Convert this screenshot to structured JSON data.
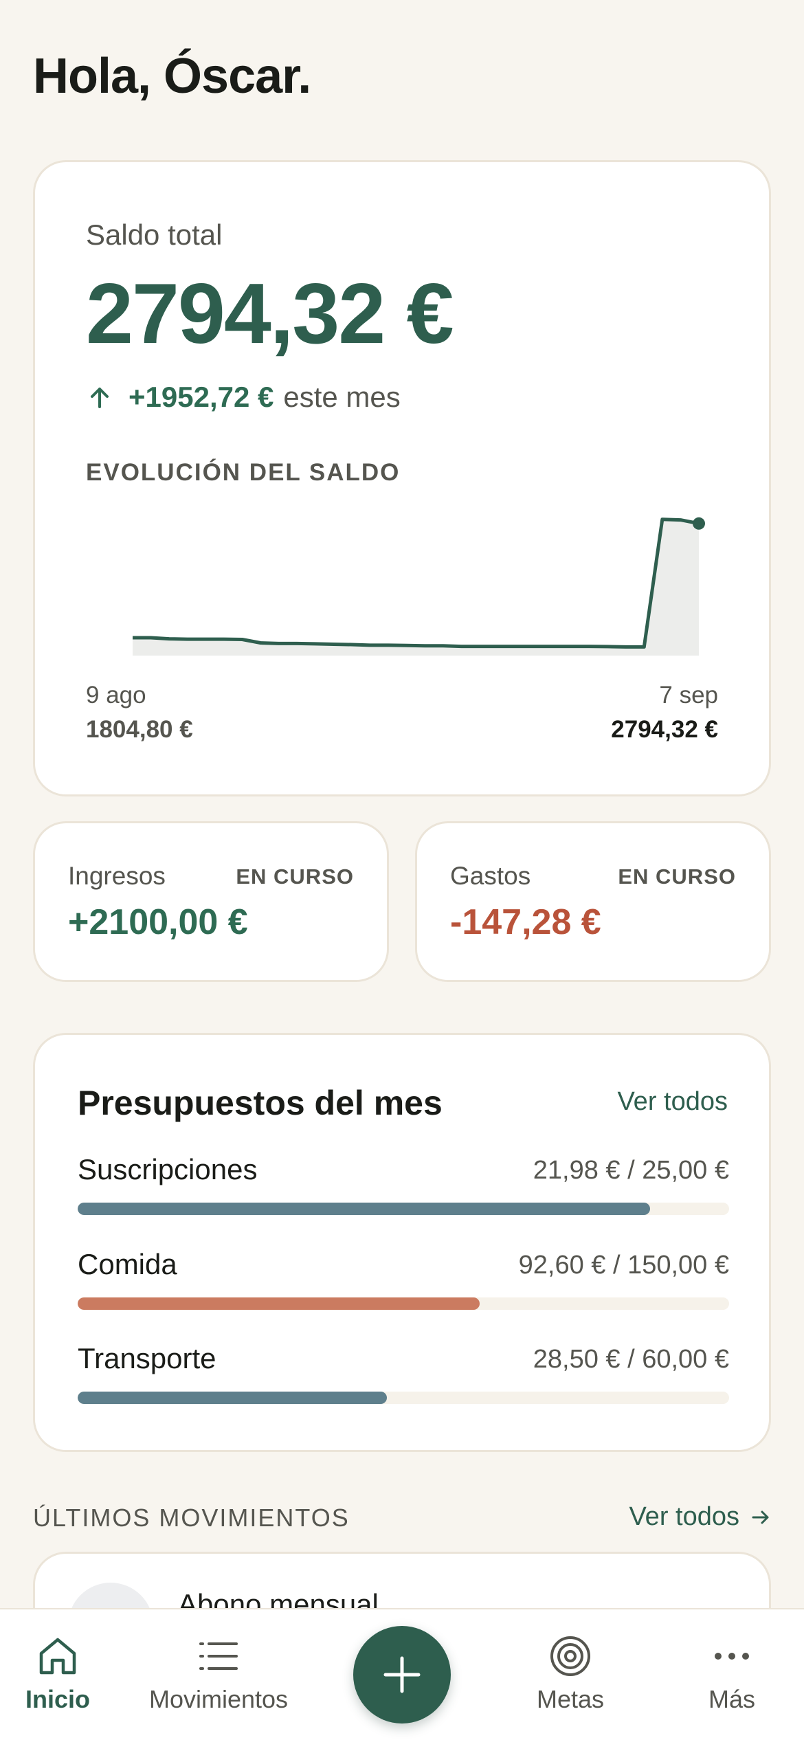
{
  "greeting": "Hola, Óscar.",
  "balance": {
    "label": "Saldo total",
    "value": "2794,32 €",
    "delta_value": "+1952,72 €",
    "delta_suffix": "este mes",
    "colors": {
      "accent": "#2e5e4e",
      "positive": "#2e6b53",
      "negative": "#b9533a"
    }
  },
  "chart_data": {
    "type": "area",
    "title": "EVOLUCIÓN DEL SALDO",
    "x_labels": [
      "9 ago",
      "7 sep"
    ],
    "start": {
      "date": "9 ago",
      "value_label": "1804,80 €"
    },
    "end": {
      "date": "7 sep",
      "value_label": "2794,32 €"
    },
    "series": [
      {
        "values": [
          1804.8,
          1804.8,
          1795,
          1792,
          1792,
          1792,
          1790,
          1760,
          1755,
          1755,
          1752,
          1748,
          1745,
          1740,
          1740,
          1738,
          1735,
          1735,
          1730,
          1730,
          1730,
          1730,
          1730,
          1730,
          1730,
          1730,
          1728,
          1725,
          1725,
          2830,
          2825,
          2794.32
        ],
        "color": "#2e5e4e",
        "fill": "#ecedeb"
      }
    ],
    "ylim": [
      1650,
      2900
    ],
    "grid": false,
    "legend": "none"
  },
  "summary": {
    "income": {
      "label": "Ingresos",
      "status": "EN CURSO",
      "value": "+2100,00 €"
    },
    "expense": {
      "label": "Gastos",
      "status": "EN CURSO",
      "value": "-147,28 €"
    }
  },
  "budgets": {
    "title": "Presupuestos del mes",
    "link": "Ver todos",
    "items": [
      {
        "name": "Suscripciones",
        "amount": "21,98 € / 25,00 €",
        "ratio": 0.8792,
        "color": "#5e7f8c"
      },
      {
        "name": "Comida",
        "amount": "92,60 € / 150,00 €",
        "ratio": 0.6173,
        "color": "#cb7b60"
      },
      {
        "name": "Transporte",
        "amount": "28,50 € / 60,00 €",
        "ratio": 0.475,
        "color": "#5e7f8c"
      }
    ]
  },
  "movements": {
    "title": "ÚLTIMOS MOVIMIENTOS",
    "link": "Ver todos",
    "items": [
      {
        "title": "Abono mensual"
      }
    ]
  },
  "tabbar": {
    "items": [
      {
        "label": "Inicio",
        "icon": "home-icon",
        "active": true
      },
      {
        "label": "Movimientos",
        "icon": "list-icon"
      },
      {
        "label": "Metas",
        "icon": "target-icon"
      },
      {
        "label": "Más",
        "icon": "more-icon"
      }
    ],
    "fab_icon": "plus-icon"
  }
}
